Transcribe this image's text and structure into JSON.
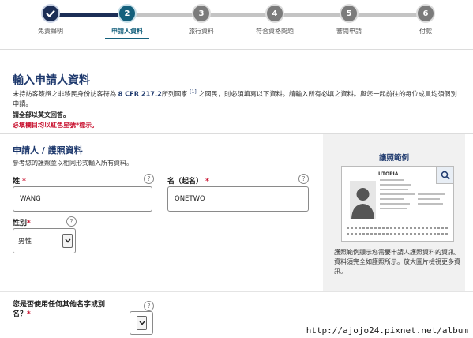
{
  "stepper": {
    "steps": [
      {
        "number": "",
        "label": "免責聲明",
        "state": "done"
      },
      {
        "number": "2",
        "label": "申請人資料",
        "state": "current"
      },
      {
        "number": "3",
        "label": "旅行資料",
        "state": "todo"
      },
      {
        "number": "4",
        "label": "符合資格問題",
        "state": "todo"
      },
      {
        "number": "5",
        "label": "審閱申請",
        "state": "todo"
      },
      {
        "number": "6",
        "label": "付款",
        "state": "todo"
      }
    ]
  },
  "header": {
    "title": "輸入申請人資料",
    "intro_pre": "未持訪客簽證之非移民身份訪客符為 ",
    "intro_cfr": "8 CFR 217.2",
    "intro_mid": "所列國家 ",
    "intro_sup": "[1]",
    "intro_post": " 之國民，則必須填寫以下資料。請輸入所有必填之資料。與您一起前往的每位成員均須個別申請。",
    "note_english": "請全部以英文回答。",
    "note_required": "必填欄目均以紅色星號*標示。"
  },
  "applicant": {
    "section_title": "申請人 / 護照資料",
    "section_desc": "參考您的護照並以相同形式輸入所有資料。",
    "surname": {
      "label": "姓",
      "value": "WANG"
    },
    "given_name": {
      "label": "名（起名）",
      "value": "ONETWO"
    },
    "gender": {
      "label": "性別",
      "value": "男性"
    },
    "other_names": {
      "label": "您是否使用任何其他名字或別名？"
    },
    "required_mark": "*",
    "help_glyph": "?"
  },
  "passport_panel": {
    "title": "護照範例",
    "country": "UTOPIA",
    "description": "護照範例顯示您需要申請人護照資料的資訊。資料須完全如護照所示。放大圖片檢視更多資訊。"
  },
  "watermark": "http://ajojo24.pixnet.net/album",
  "colors": {
    "navy": "#1c2e56",
    "teal": "#14607c",
    "required_red": "#c8102e"
  },
  "icons": [
    "check-icon",
    "help-icon",
    "chevron-down-icon",
    "magnifier-icon",
    "person-silhouette-icon"
  ]
}
